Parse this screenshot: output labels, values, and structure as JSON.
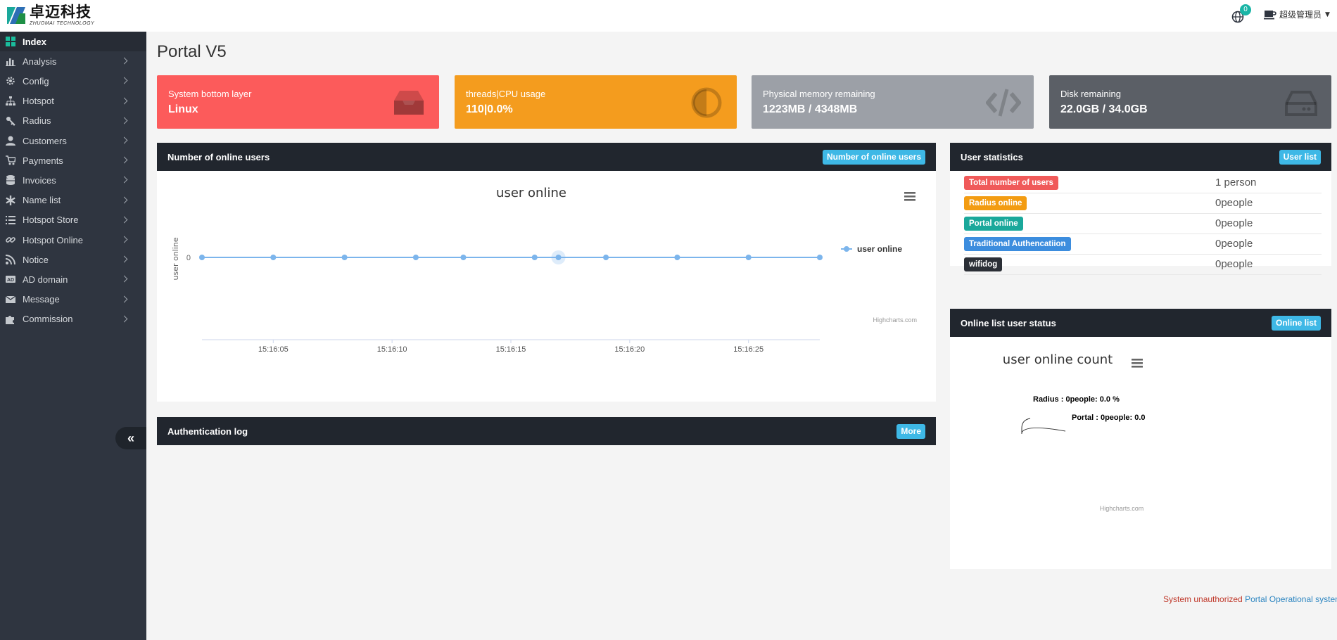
{
  "header": {
    "logo_text": "卓迈科技",
    "logo_subtext": "ZHUOMAI TECHNOLOGY",
    "notification_badge": "0",
    "user_name": "超级管理员"
  },
  "sidebar": {
    "items": [
      {
        "label": "Index",
        "icon": "grid-icon",
        "active": true
      },
      {
        "label": "Analysis",
        "icon": "bar-chart-icon"
      },
      {
        "label": "Config",
        "icon": "gear-icon"
      },
      {
        "label": "Hotspot",
        "icon": "sitemap-icon"
      },
      {
        "label": "Radius",
        "icon": "key-icon"
      },
      {
        "label": "Customers",
        "icon": "user-icon"
      },
      {
        "label": "Payments",
        "icon": "cart-icon"
      },
      {
        "label": "Invoices",
        "icon": "database-icon"
      },
      {
        "label": "Name list",
        "icon": "asterisk-icon"
      },
      {
        "label": "Hotspot Store",
        "icon": "list-icon"
      },
      {
        "label": "Hotspot Online",
        "icon": "link-icon"
      },
      {
        "label": "Notice",
        "icon": "rss-icon"
      },
      {
        "label": "AD domain",
        "icon": "ad-icon"
      },
      {
        "label": "Message",
        "icon": "envelope-icon"
      },
      {
        "label": "Commission",
        "icon": "puzzle-icon"
      }
    ],
    "collapse_label": "«"
  },
  "page": {
    "title": "Portal V5"
  },
  "stats": [
    {
      "label": "System bottom layer",
      "value": "Linux",
      "color": "#fc5b5b",
      "icon": "inbox-icon"
    },
    {
      "label": "threads|CPU usage",
      "value": "110|0.0%",
      "color": "#f49c1e",
      "icon": "adjust-icon"
    },
    {
      "label": "Physical memory remaining",
      "value": "1223MB / 4348MB",
      "color": "#9ca0a7",
      "icon": "code-icon"
    },
    {
      "label": "Disk remaining",
      "value": "22.0GB / 34.0GB",
      "color": "#5b5f66",
      "icon": "hdd-icon"
    }
  ],
  "online_panel": {
    "title": "Number of online users",
    "button": "Number of online users"
  },
  "user_stats_panel": {
    "title": "User statistics",
    "button": "User list",
    "rows": [
      {
        "label": "Total number of users",
        "count": "1 person",
        "color": "#f05a5a"
      },
      {
        "label": "Radius online",
        "count": "0people",
        "color": "#f39c12"
      },
      {
        "label": "Portal online",
        "count": "0people",
        "color": "#1aa89b"
      },
      {
        "label": "Traditional Authencatiion",
        "count": "0people",
        "color": "#3c8dde"
      },
      {
        "label": "wifidog",
        "count": "0people",
        "color": "#2b2f36"
      }
    ]
  },
  "status_panel": {
    "title": "Online list user status",
    "button": "Online list"
  },
  "auth_panel": {
    "title": "Authentication log",
    "button": "More"
  },
  "chart_data": [
    {
      "type": "line",
      "title": "user online",
      "ylabel": "user online",
      "xlabel": "",
      "x": [
        "15:16:02",
        "15:16:05",
        "15:16:08",
        "15:16:11",
        "15:16:13",
        "15:16:16",
        "15:16:17",
        "15:16:19",
        "15:16:22",
        "15:16:25",
        "15:16:28"
      ],
      "x_ticks": [
        "15:16:05",
        "15:16:10",
        "15:16:15",
        "15:16:20",
        "15:16:25"
      ],
      "y_ticks": [
        "0"
      ],
      "series": [
        {
          "name": "user online",
          "values": [
            0,
            0,
            0,
            0,
            0,
            0,
            0,
            0,
            0,
            0,
            0
          ],
          "color": "#7cb5ec"
        }
      ],
      "highlight_index": 6,
      "legend": "right",
      "credit": "Highcharts.com"
    },
    {
      "type": "pie",
      "title": "user online count",
      "slices": [
        {
          "name": "Radius",
          "label": "Radius : 0people: 0.0 %",
          "value": 0
        },
        {
          "name": "Portal",
          "label": "Portal : 0people: 0.0",
          "value": 0
        }
      ],
      "credit": "Highcharts.com"
    }
  ],
  "footer": {
    "red_text": "System unauthorized",
    "blue_text": "Portal Operational system"
  }
}
